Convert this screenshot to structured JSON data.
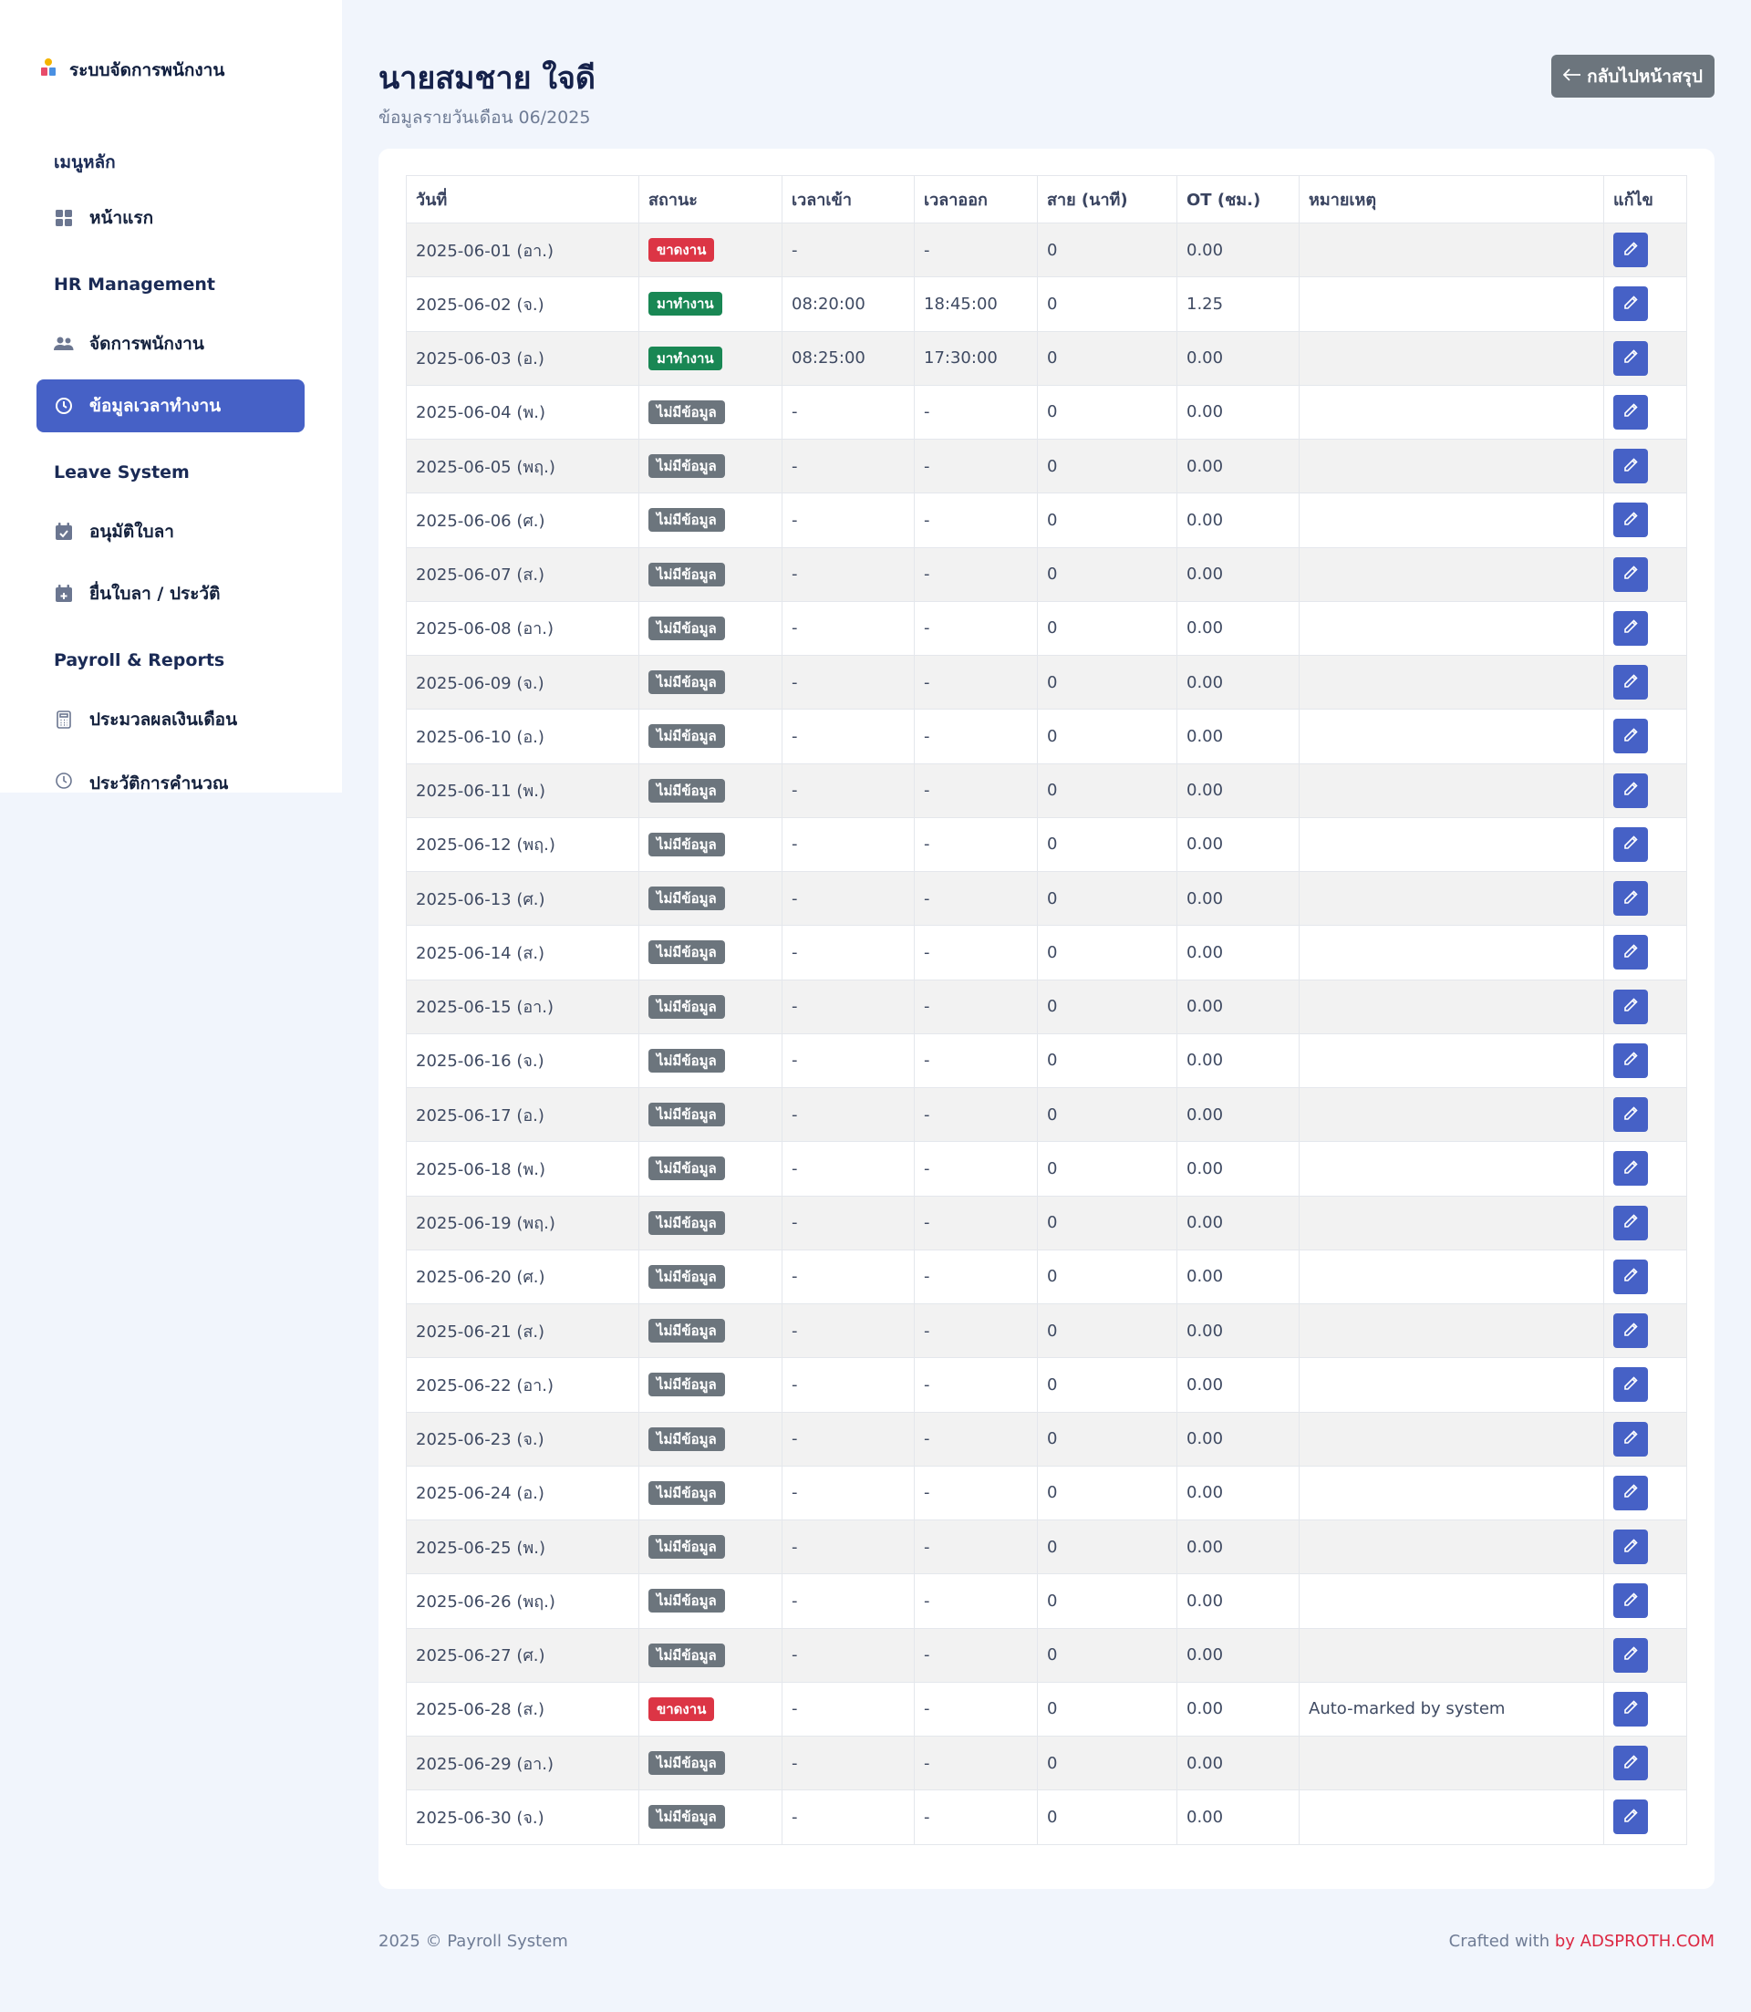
{
  "sidebar": {
    "brand": "ระบบจัดการพนักงาน",
    "sections": {
      "main": "เมนูหลัก",
      "hr": "HR Management",
      "leave": "Leave System",
      "payroll": "Payroll & Reports"
    },
    "items": {
      "home": "หน้าแรก",
      "employees": "จัดการพนักงาน",
      "attendance": "ข้อมูลเวลาทำงาน",
      "leave_approve": "อนุมัติใบลา",
      "leave_request": "ยื่นใบลา / ประวัติ",
      "payroll_process": "ประมวลผลเงินเดือน",
      "calc_history": "ประวัติการคำนวณ"
    }
  },
  "header": {
    "title": "นายสมชาย ใจดี",
    "subtitle": "ข้อมูลรายวันเดือน 06/2025",
    "back_label": "กลับไปหน้าสรุป"
  },
  "table": {
    "columns": [
      "วันที่",
      "สถานะ",
      "เวลาเข้า",
      "เวลาออก",
      "สาย (นาที)",
      "OT (ชม.)",
      "หมายเหตุ",
      "แก้ไข"
    ],
    "rows": [
      {
        "date": "2025-06-01 (อา.)",
        "status": "ขาดงาน",
        "status_type": "absent",
        "in": "-",
        "out": "-",
        "late": "0",
        "ot": "0.00",
        "note": ""
      },
      {
        "date": "2025-06-02 (จ.)",
        "status": "มาทำงาน",
        "status_type": "present",
        "in": "08:20:00",
        "out": "18:45:00",
        "late": "0",
        "ot": "1.25",
        "note": ""
      },
      {
        "date": "2025-06-03 (อ.)",
        "status": "มาทำงาน",
        "status_type": "present",
        "in": "08:25:00",
        "out": "17:30:00",
        "late": "0",
        "ot": "0.00",
        "note": ""
      },
      {
        "date": "2025-06-04 (พ.)",
        "status": "ไม่มีข้อมูล",
        "status_type": "nodata",
        "in": "-",
        "out": "-",
        "late": "0",
        "ot": "0.00",
        "note": ""
      },
      {
        "date": "2025-06-05 (พฤ.)",
        "status": "ไม่มีข้อมูล",
        "status_type": "nodata",
        "in": "-",
        "out": "-",
        "late": "0",
        "ot": "0.00",
        "note": ""
      },
      {
        "date": "2025-06-06 (ศ.)",
        "status": "ไม่มีข้อมูล",
        "status_type": "nodata",
        "in": "-",
        "out": "-",
        "late": "0",
        "ot": "0.00",
        "note": ""
      },
      {
        "date": "2025-06-07 (ส.)",
        "status": "ไม่มีข้อมูล",
        "status_type": "nodata",
        "in": "-",
        "out": "-",
        "late": "0",
        "ot": "0.00",
        "note": ""
      },
      {
        "date": "2025-06-08 (อา.)",
        "status": "ไม่มีข้อมูล",
        "status_type": "nodata",
        "in": "-",
        "out": "-",
        "late": "0",
        "ot": "0.00",
        "note": ""
      },
      {
        "date": "2025-06-09 (จ.)",
        "status": "ไม่มีข้อมูล",
        "status_type": "nodata",
        "in": "-",
        "out": "-",
        "late": "0",
        "ot": "0.00",
        "note": ""
      },
      {
        "date": "2025-06-10 (อ.)",
        "status": "ไม่มีข้อมูล",
        "status_type": "nodata",
        "in": "-",
        "out": "-",
        "late": "0",
        "ot": "0.00",
        "note": ""
      },
      {
        "date": "2025-06-11 (พ.)",
        "status": "ไม่มีข้อมูล",
        "status_type": "nodata",
        "in": "-",
        "out": "-",
        "late": "0",
        "ot": "0.00",
        "note": ""
      },
      {
        "date": "2025-06-12 (พฤ.)",
        "status": "ไม่มีข้อมูล",
        "status_type": "nodata",
        "in": "-",
        "out": "-",
        "late": "0",
        "ot": "0.00",
        "note": ""
      },
      {
        "date": "2025-06-13 (ศ.)",
        "status": "ไม่มีข้อมูล",
        "status_type": "nodata",
        "in": "-",
        "out": "-",
        "late": "0",
        "ot": "0.00",
        "note": ""
      },
      {
        "date": "2025-06-14 (ส.)",
        "status": "ไม่มีข้อมูล",
        "status_type": "nodata",
        "in": "-",
        "out": "-",
        "late": "0",
        "ot": "0.00",
        "note": ""
      },
      {
        "date": "2025-06-15 (อา.)",
        "status": "ไม่มีข้อมูล",
        "status_type": "nodata",
        "in": "-",
        "out": "-",
        "late": "0",
        "ot": "0.00",
        "note": ""
      },
      {
        "date": "2025-06-16 (จ.)",
        "status": "ไม่มีข้อมูล",
        "status_type": "nodata",
        "in": "-",
        "out": "-",
        "late": "0",
        "ot": "0.00",
        "note": ""
      },
      {
        "date": "2025-06-17 (อ.)",
        "status": "ไม่มีข้อมูล",
        "status_type": "nodata",
        "in": "-",
        "out": "-",
        "late": "0",
        "ot": "0.00",
        "note": ""
      },
      {
        "date": "2025-06-18 (พ.)",
        "status": "ไม่มีข้อมูล",
        "status_type": "nodata",
        "in": "-",
        "out": "-",
        "late": "0",
        "ot": "0.00",
        "note": ""
      },
      {
        "date": "2025-06-19 (พฤ.)",
        "status": "ไม่มีข้อมูล",
        "status_type": "nodata",
        "in": "-",
        "out": "-",
        "late": "0",
        "ot": "0.00",
        "note": ""
      },
      {
        "date": "2025-06-20 (ศ.)",
        "status": "ไม่มีข้อมูล",
        "status_type": "nodata",
        "in": "-",
        "out": "-",
        "late": "0",
        "ot": "0.00",
        "note": ""
      },
      {
        "date": "2025-06-21 (ส.)",
        "status": "ไม่มีข้อมูล",
        "status_type": "nodata",
        "in": "-",
        "out": "-",
        "late": "0",
        "ot": "0.00",
        "note": ""
      },
      {
        "date": "2025-06-22 (อา.)",
        "status": "ไม่มีข้อมูล",
        "status_type": "nodata",
        "in": "-",
        "out": "-",
        "late": "0",
        "ot": "0.00",
        "note": ""
      },
      {
        "date": "2025-06-23 (จ.)",
        "status": "ไม่มีข้อมูล",
        "status_type": "nodata",
        "in": "-",
        "out": "-",
        "late": "0",
        "ot": "0.00",
        "note": ""
      },
      {
        "date": "2025-06-24 (อ.)",
        "status": "ไม่มีข้อมูล",
        "status_type": "nodata",
        "in": "-",
        "out": "-",
        "late": "0",
        "ot": "0.00",
        "note": ""
      },
      {
        "date": "2025-06-25 (พ.)",
        "status": "ไม่มีข้อมูล",
        "status_type": "nodata",
        "in": "-",
        "out": "-",
        "late": "0",
        "ot": "0.00",
        "note": ""
      },
      {
        "date": "2025-06-26 (พฤ.)",
        "status": "ไม่มีข้อมูล",
        "status_type": "nodata",
        "in": "-",
        "out": "-",
        "late": "0",
        "ot": "0.00",
        "note": ""
      },
      {
        "date": "2025-06-27 (ศ.)",
        "status": "ไม่มีข้อมูล",
        "status_type": "nodata",
        "in": "-",
        "out": "-",
        "late": "0",
        "ot": "0.00",
        "note": ""
      },
      {
        "date": "2025-06-28 (ส.)",
        "status": "ขาดงาน",
        "status_type": "absent",
        "in": "-",
        "out": "-",
        "late": "0",
        "ot": "0.00",
        "note": "Auto-marked by system"
      },
      {
        "date": "2025-06-29 (อา.)",
        "status": "ไม่มีข้อมูล",
        "status_type": "nodata",
        "in": "-",
        "out": "-",
        "late": "0",
        "ot": "0.00",
        "note": ""
      },
      {
        "date": "2025-06-30 (จ.)",
        "status": "ไม่มีข้อมูล",
        "status_type": "nodata",
        "in": "-",
        "out": "-",
        "late": "0",
        "ot": "0.00",
        "note": ""
      }
    ]
  },
  "footer": {
    "copyright": "2025 © Payroll System",
    "crafted": "Crafted with ",
    "by": "by ADSPROTH.COM"
  },
  "colors": {
    "primary": "#4661c6",
    "absent": "#dc3545",
    "present": "#198754",
    "nodata": "#6c757d",
    "background": "#f1f5fc"
  }
}
